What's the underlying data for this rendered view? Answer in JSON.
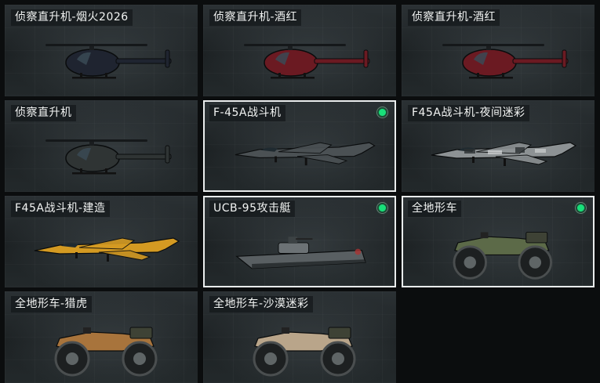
{
  "items": [
    {
      "label": "侦察直升机-烟火2026",
      "selected": false,
      "equipped": false,
      "kind": "helicopter",
      "color": "#1f2430"
    },
    {
      "label": "侦察直升机-酒红",
      "selected": false,
      "equipped": false,
      "kind": "helicopter",
      "color": "#6b1a22"
    },
    {
      "label": "侦察直升机-酒红",
      "selected": false,
      "equipped": false,
      "kind": "helicopter",
      "color": "#6b1a22"
    },
    {
      "label": "侦察直升机",
      "selected": false,
      "equipped": false,
      "kind": "helicopter",
      "color": "#2f3434"
    },
    {
      "label": "F-45A战斗机",
      "selected": true,
      "equipped": true,
      "kind": "jet",
      "color": "#4b5154"
    },
    {
      "label": "F45A战斗机-夜间迷彩",
      "selected": false,
      "equipped": false,
      "kind": "jet-camo",
      "color": "#8d9294"
    },
    {
      "label": "F45A战斗机-建造",
      "selected": false,
      "equipped": false,
      "kind": "jet",
      "color": "#d49a22"
    },
    {
      "label": "UCB-95攻击艇",
      "selected": true,
      "equipped": true,
      "kind": "boat",
      "color": "#595f62"
    },
    {
      "label": "全地形车",
      "selected": true,
      "equipped": true,
      "kind": "atv",
      "color": "#5c6a48"
    },
    {
      "label": "全地形车-猎虎",
      "selected": false,
      "equipped": false,
      "kind": "atv",
      "color": "#a8743c"
    },
    {
      "label": "全地形车-沙漠迷彩",
      "selected": false,
      "equipped": false,
      "kind": "atv",
      "color": "#b9a58a"
    }
  ]
}
